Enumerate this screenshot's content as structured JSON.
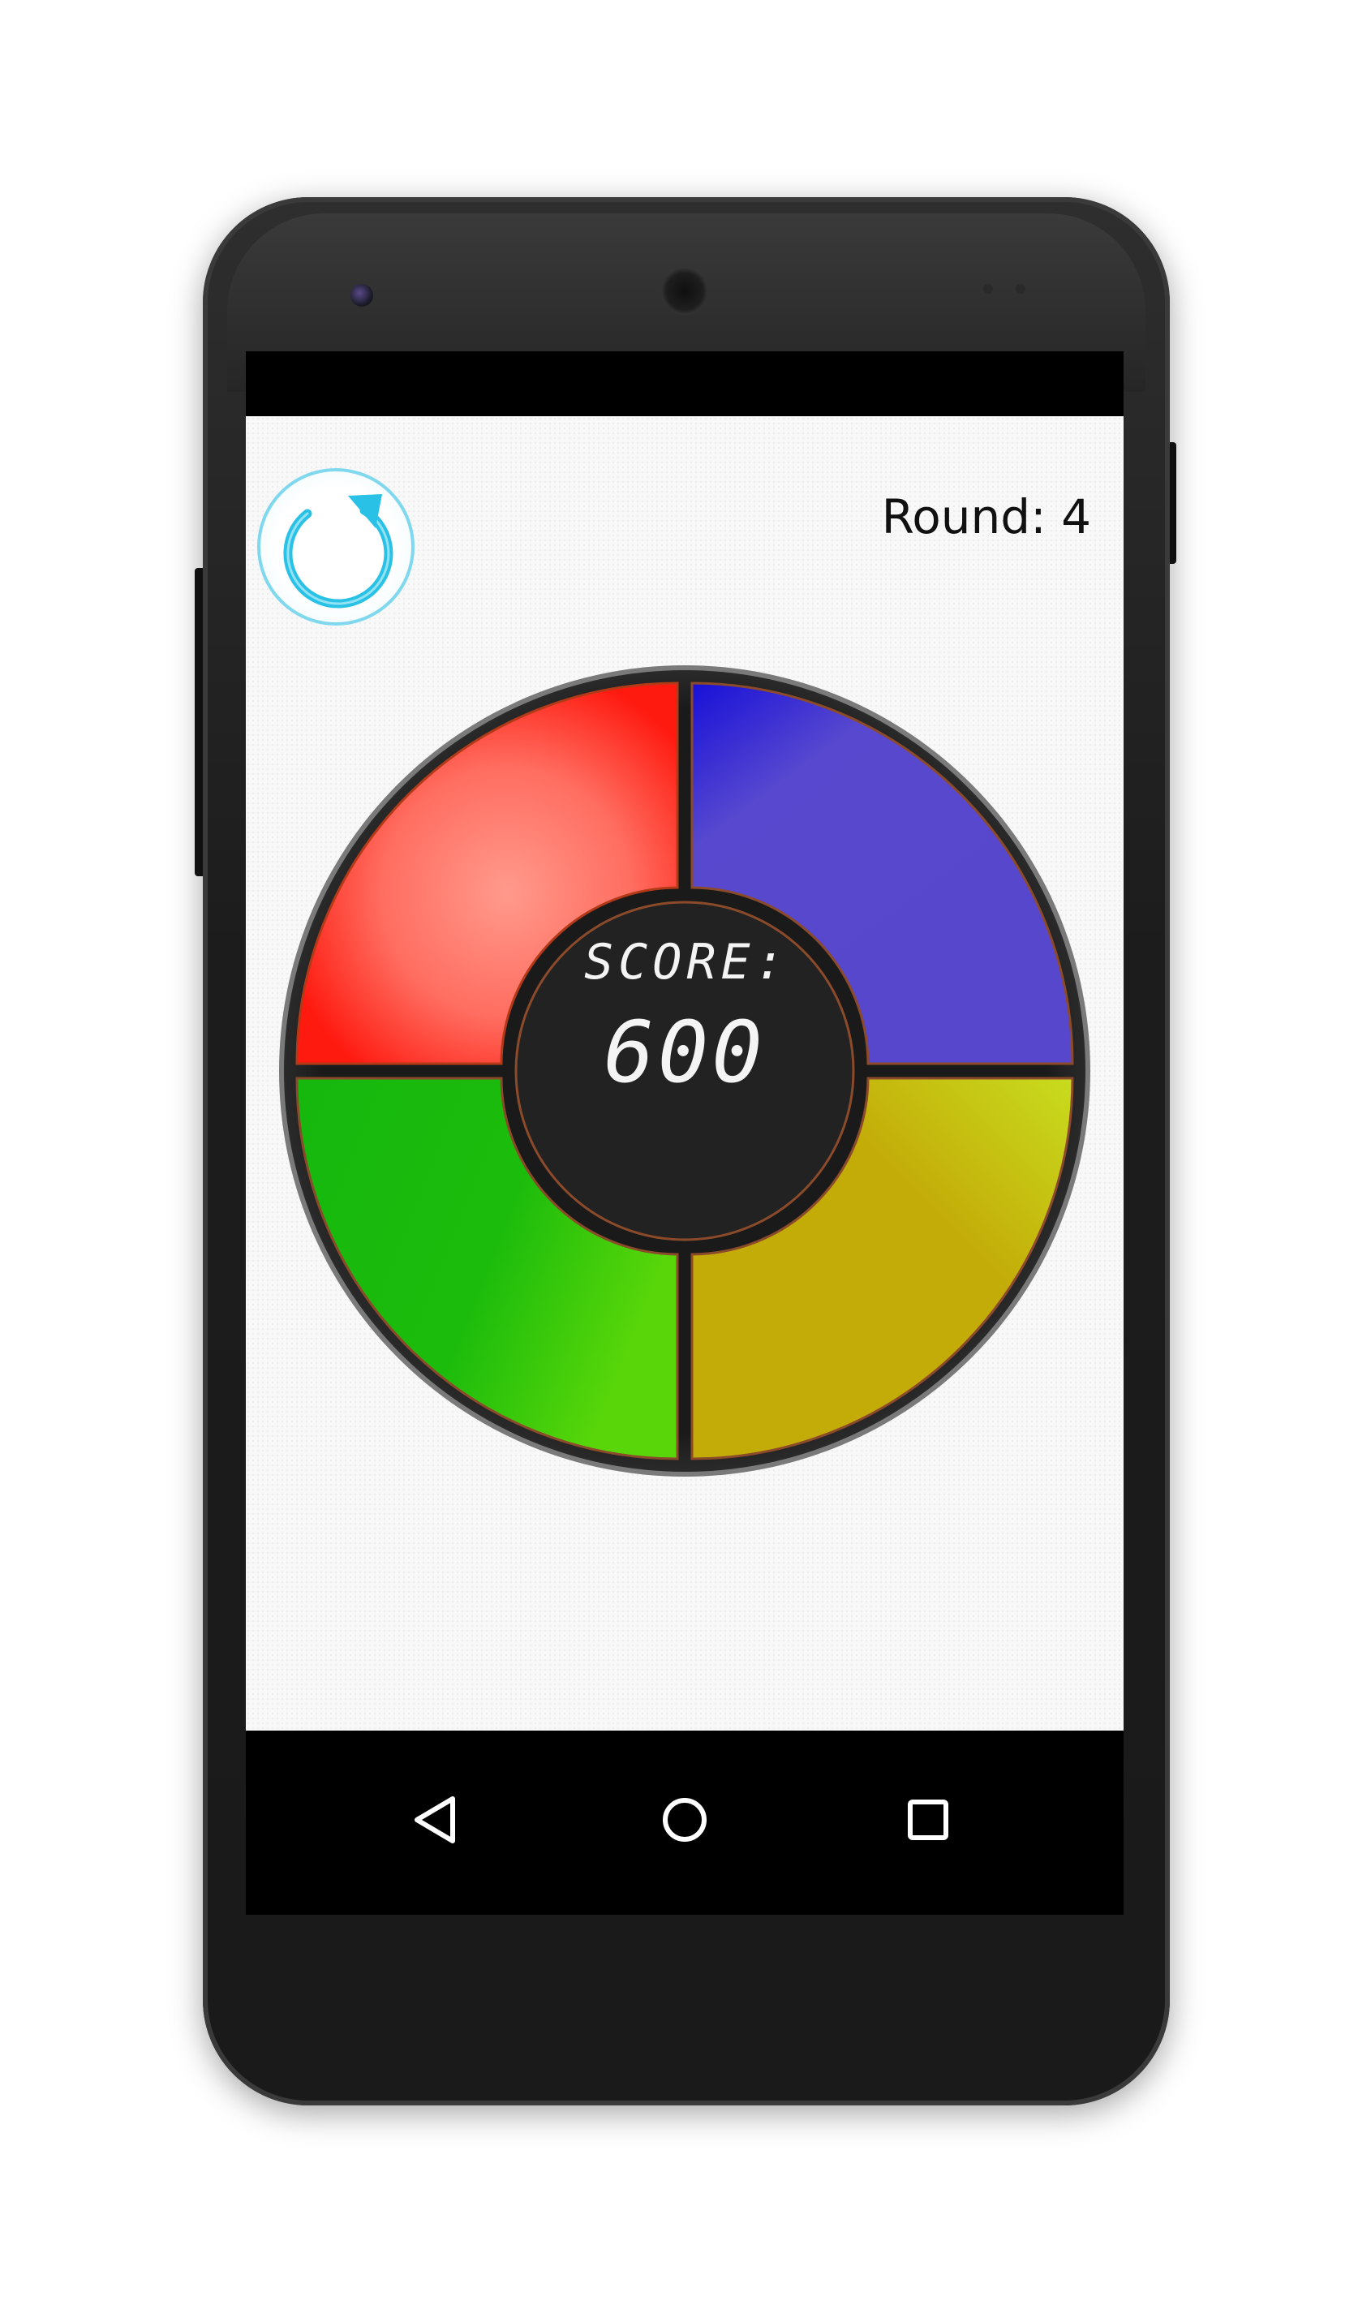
{
  "device": {
    "name": "android-phone"
  },
  "game": {
    "round_label": "Round: 4",
    "score_title": "SCORE:",
    "score_value": "600",
    "colors": {
      "red": "#ff3b2f",
      "blue": "#5747cc",
      "green": "#1cbc0c",
      "yellow": "#c4ac08",
      "center": "#222222",
      "restart_accent": "#29c2e6"
    },
    "pads": [
      "red-pad",
      "blue-pad",
      "green-pad",
      "yellow-pad"
    ],
    "restart_icon": "restart-icon"
  },
  "navigation": {
    "back_icon": "back-triangle-icon",
    "home_icon": "home-circle-icon",
    "recent_icon": "recent-apps-square-icon"
  }
}
